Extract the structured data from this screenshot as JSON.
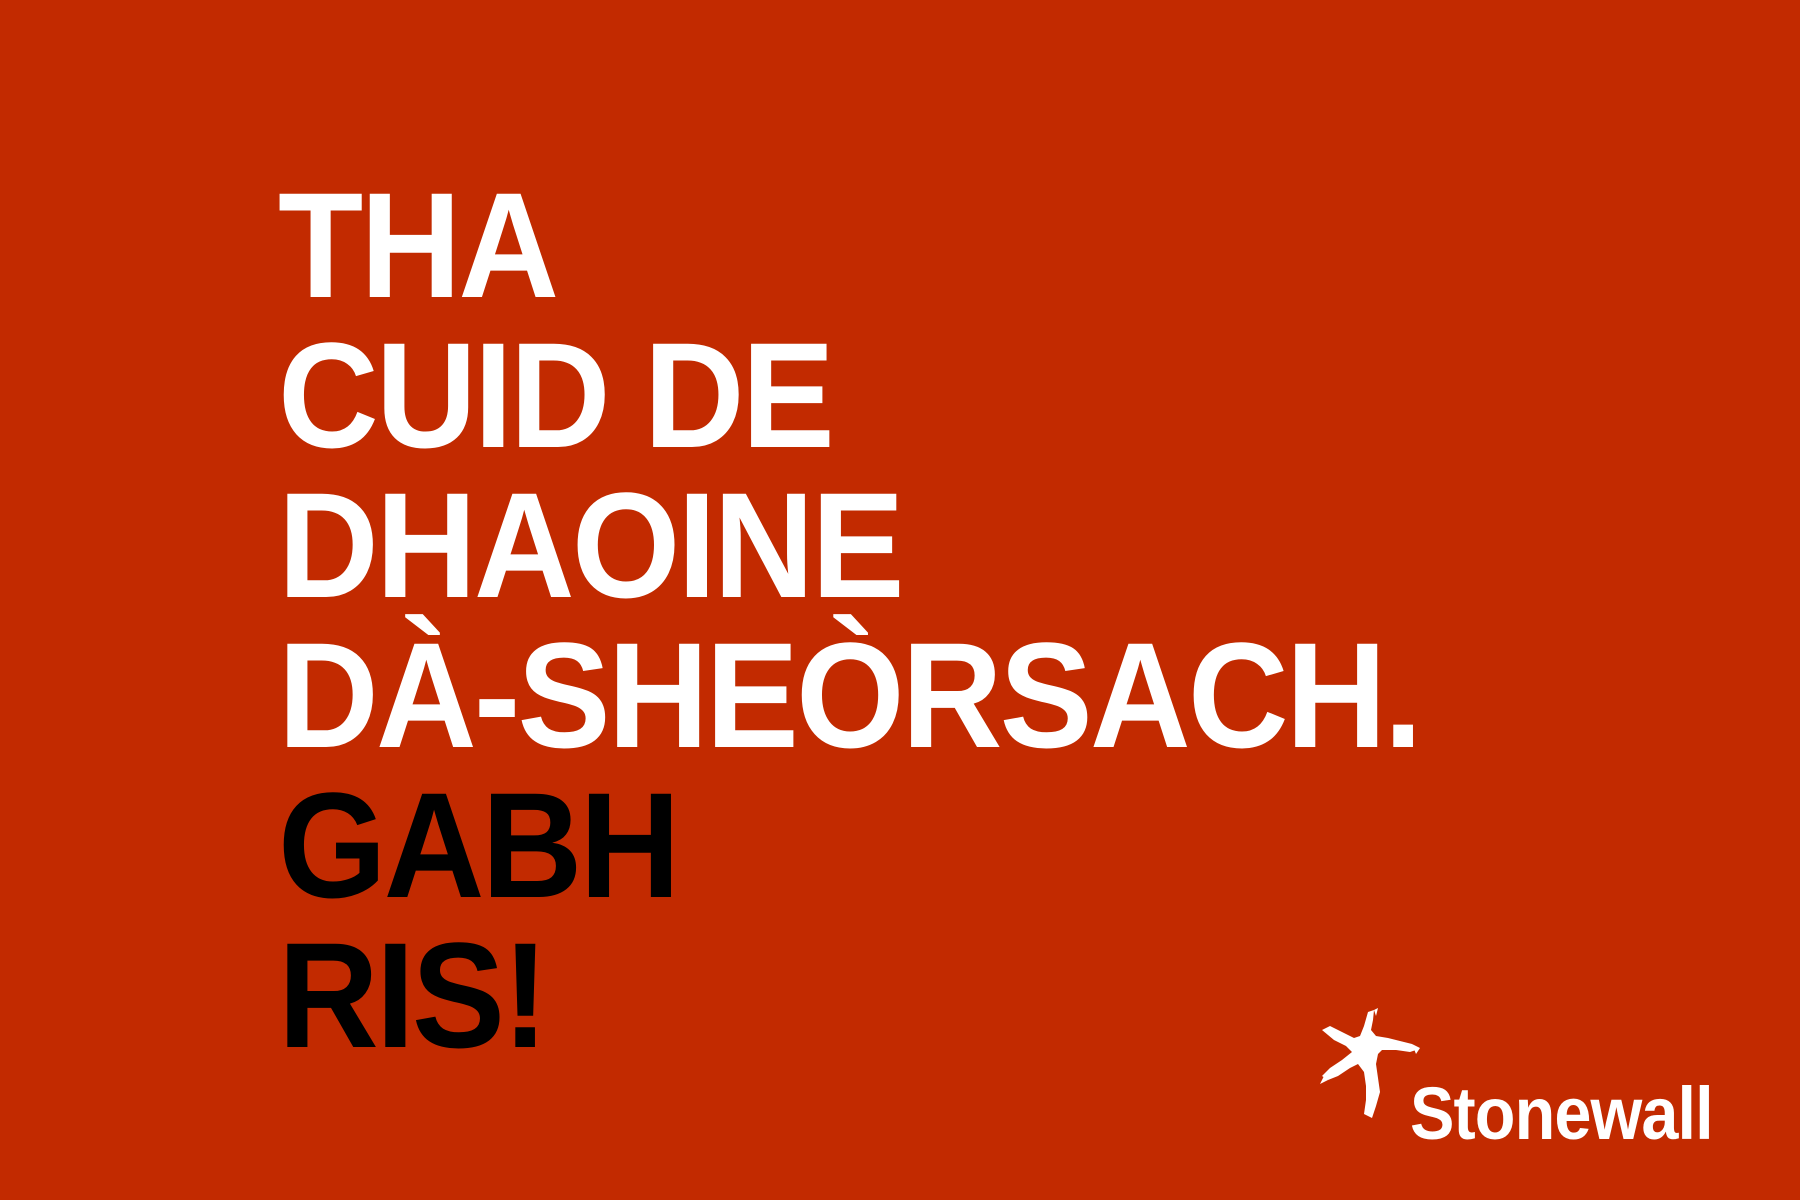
{
  "poster": {
    "background_color": "#c22a00",
    "headline_lines": [
      {
        "text": "THA",
        "color": "#ffffff"
      },
      {
        "text": "CUID DE",
        "color": "#ffffff"
      },
      {
        "text": "DHAOINE",
        "color": "#ffffff"
      },
      {
        "text": "DÀ-SHEÒRSACH.",
        "color": "#ffffff"
      },
      {
        "text": "GABH",
        "color": "#000000"
      },
      {
        "text": "RIS!",
        "color": "#000000"
      }
    ]
  },
  "logo": {
    "name": "Stonewall",
    "icon": "star-figure-icon",
    "color": "#ffffff"
  }
}
